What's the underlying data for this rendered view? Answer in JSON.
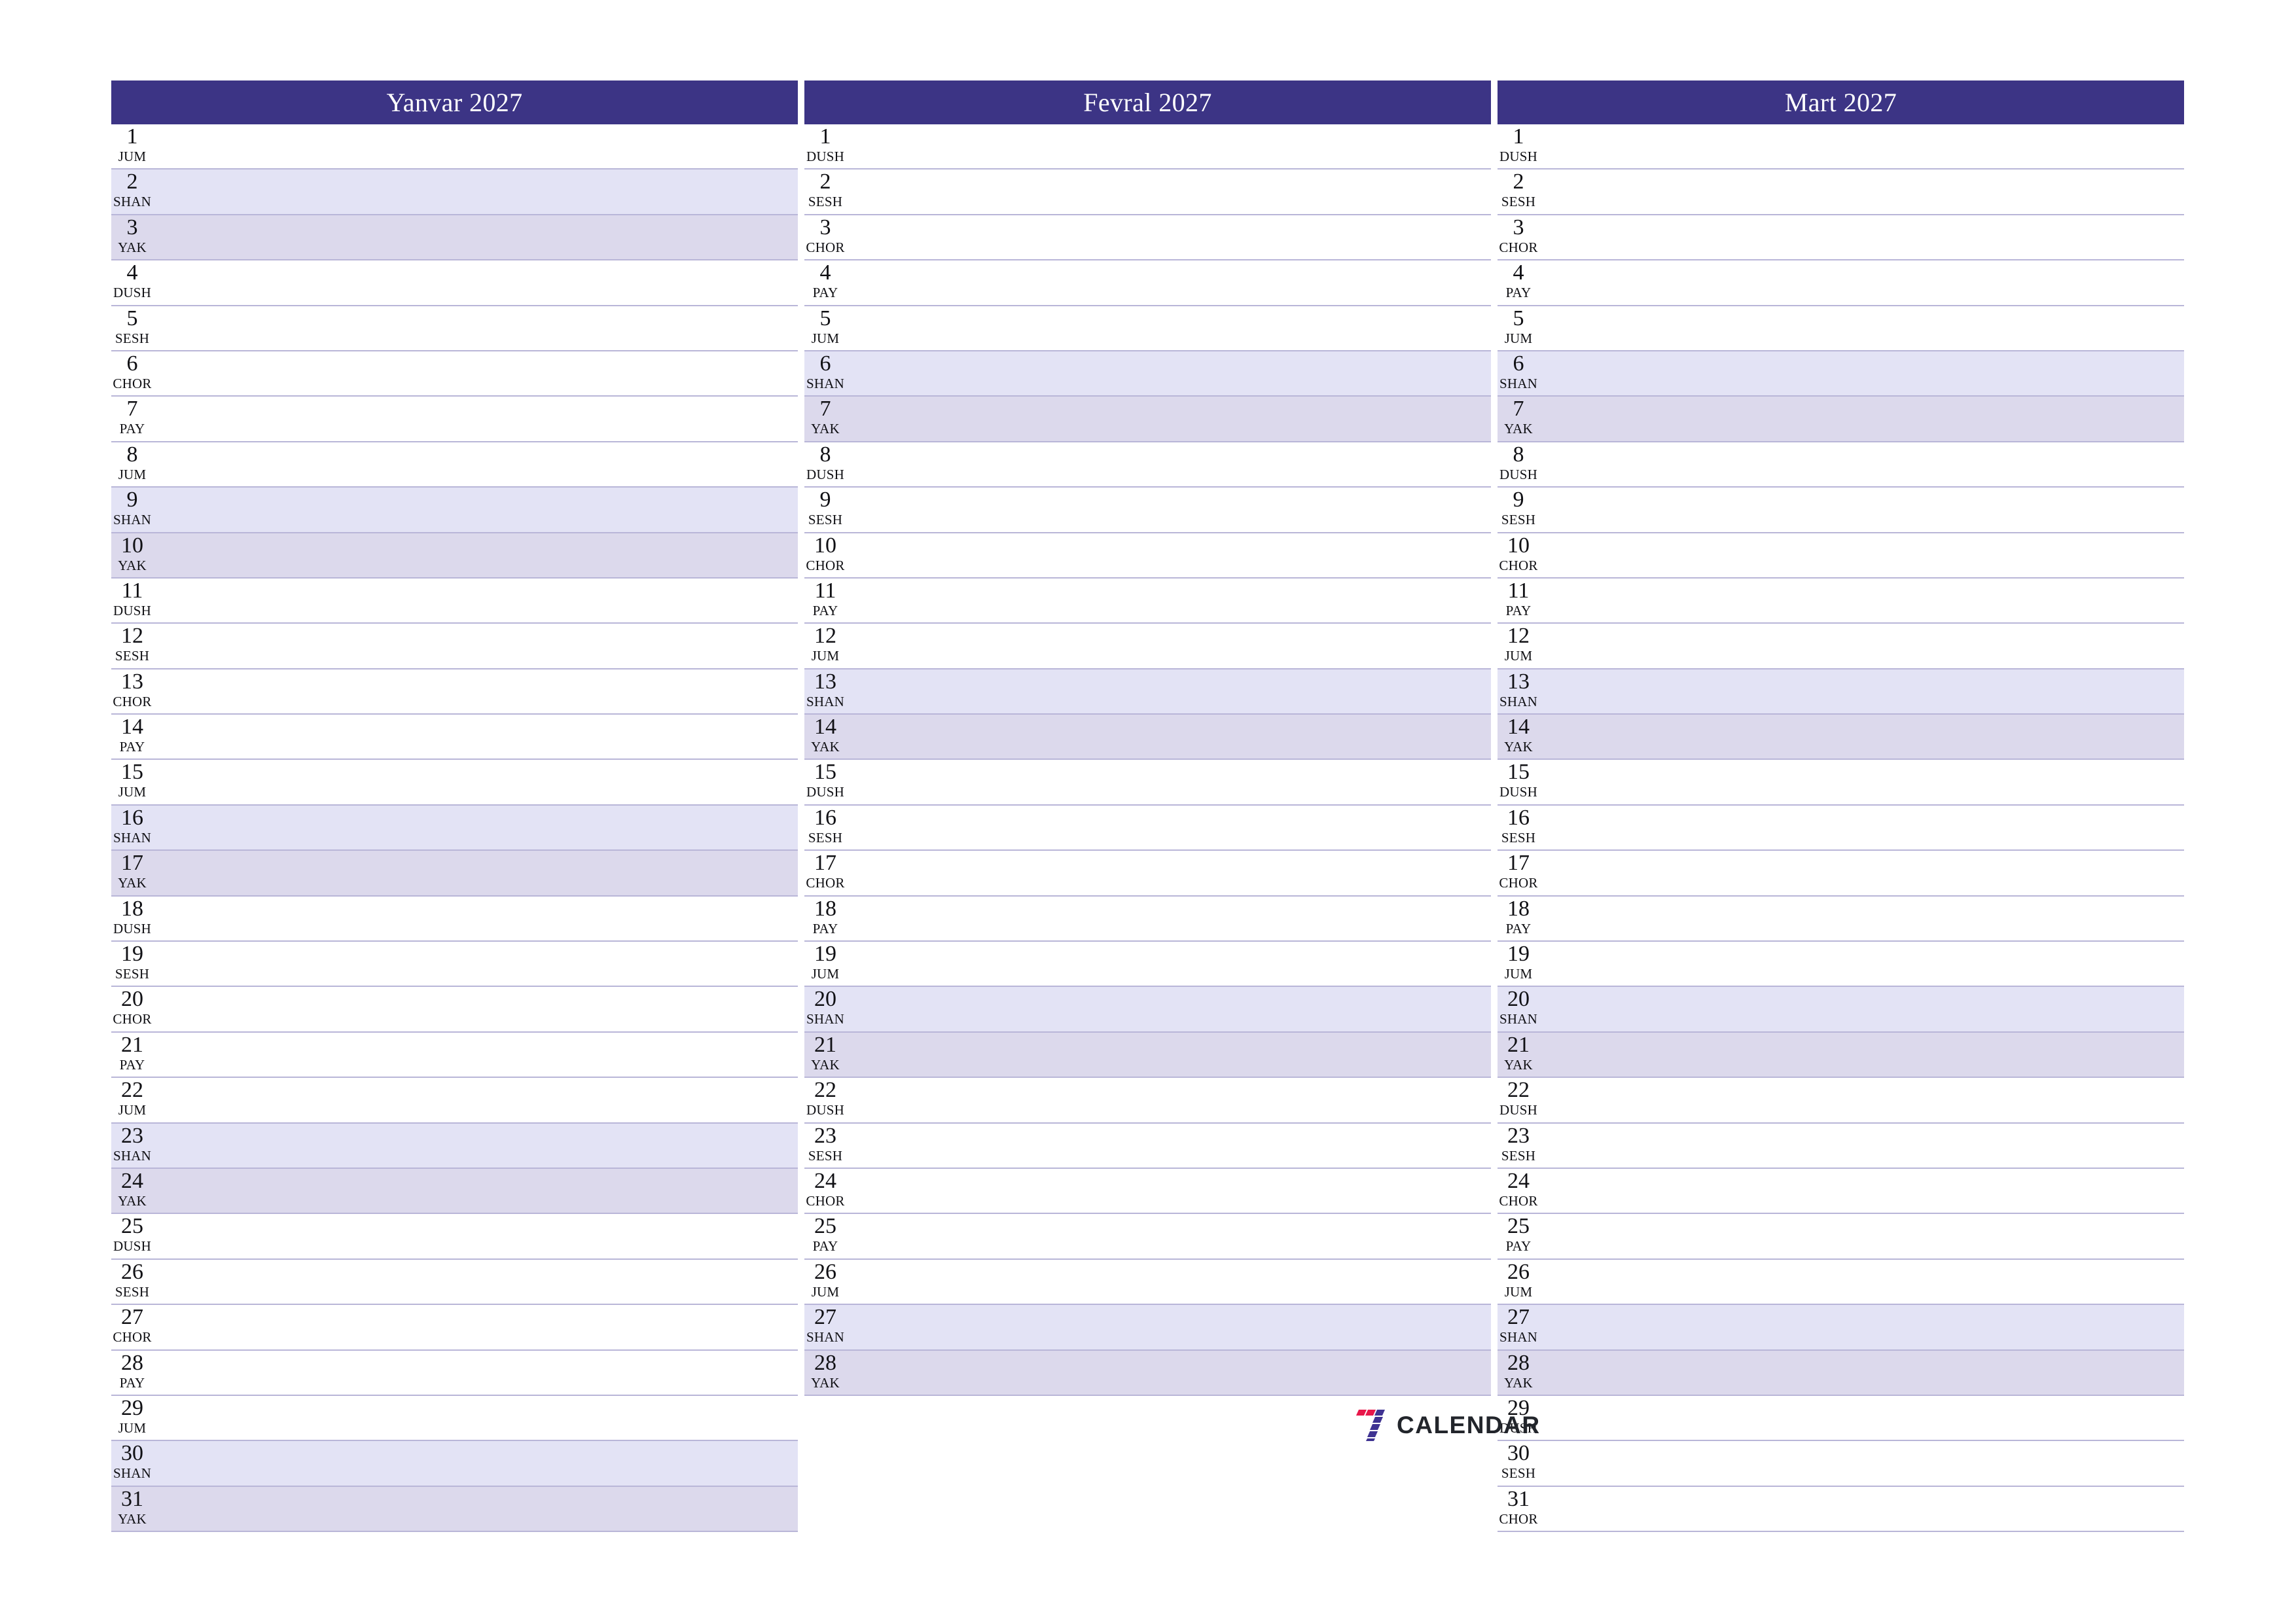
{
  "theme": {
    "header_bg": "#3c3485",
    "header_text": "#ffffff",
    "saturday_bg": "#e3e3f5",
    "sunday_bg": "#dcd9ec",
    "row_border": "#b9b6d8",
    "page_bg": "#ffffff",
    "text": "#101014",
    "logo_red": "#e8174a",
    "logo_blue": "#3f3392"
  },
  "brand": {
    "mark": "seven-logo-icon",
    "word": "CALENDAR"
  },
  "months": [
    {
      "title": "Yanvar 2027",
      "days": [
        {
          "num": "1",
          "name": "JUM",
          "type": "weekday"
        },
        {
          "num": "2",
          "name": "SHAN",
          "type": "saturday"
        },
        {
          "num": "3",
          "name": "YAK",
          "type": "sunday"
        },
        {
          "num": "4",
          "name": "DUSH",
          "type": "weekday"
        },
        {
          "num": "5",
          "name": "SESH",
          "type": "weekday"
        },
        {
          "num": "6",
          "name": "CHOR",
          "type": "weekday"
        },
        {
          "num": "7",
          "name": "PAY",
          "type": "weekday"
        },
        {
          "num": "8",
          "name": "JUM",
          "type": "weekday"
        },
        {
          "num": "9",
          "name": "SHAN",
          "type": "saturday"
        },
        {
          "num": "10",
          "name": "YAK",
          "type": "sunday"
        },
        {
          "num": "11",
          "name": "DUSH",
          "type": "weekday"
        },
        {
          "num": "12",
          "name": "SESH",
          "type": "weekday"
        },
        {
          "num": "13",
          "name": "CHOR",
          "type": "weekday"
        },
        {
          "num": "14",
          "name": "PAY",
          "type": "weekday"
        },
        {
          "num": "15",
          "name": "JUM",
          "type": "weekday"
        },
        {
          "num": "16",
          "name": "SHAN",
          "type": "saturday"
        },
        {
          "num": "17",
          "name": "YAK",
          "type": "sunday"
        },
        {
          "num": "18",
          "name": "DUSH",
          "type": "weekday"
        },
        {
          "num": "19",
          "name": "SESH",
          "type": "weekday"
        },
        {
          "num": "20",
          "name": "CHOR",
          "type": "weekday"
        },
        {
          "num": "21",
          "name": "PAY",
          "type": "weekday"
        },
        {
          "num": "22",
          "name": "JUM",
          "type": "weekday"
        },
        {
          "num": "23",
          "name": "SHAN",
          "type": "saturday"
        },
        {
          "num": "24",
          "name": "YAK",
          "type": "sunday"
        },
        {
          "num": "25",
          "name": "DUSH",
          "type": "weekday"
        },
        {
          "num": "26",
          "name": "SESH",
          "type": "weekday"
        },
        {
          "num": "27",
          "name": "CHOR",
          "type": "weekday"
        },
        {
          "num": "28",
          "name": "PAY",
          "type": "weekday"
        },
        {
          "num": "29",
          "name": "JUM",
          "type": "weekday"
        },
        {
          "num": "30",
          "name": "SHAN",
          "type": "saturday"
        },
        {
          "num": "31",
          "name": "YAK",
          "type": "sunday"
        }
      ]
    },
    {
      "title": "Fevral 2027",
      "days": [
        {
          "num": "1",
          "name": "DUSH",
          "type": "weekday"
        },
        {
          "num": "2",
          "name": "SESH",
          "type": "weekday"
        },
        {
          "num": "3",
          "name": "CHOR",
          "type": "weekday"
        },
        {
          "num": "4",
          "name": "PAY",
          "type": "weekday"
        },
        {
          "num": "5",
          "name": "JUM",
          "type": "weekday"
        },
        {
          "num": "6",
          "name": "SHAN",
          "type": "saturday"
        },
        {
          "num": "7",
          "name": "YAK",
          "type": "sunday"
        },
        {
          "num": "8",
          "name": "DUSH",
          "type": "weekday"
        },
        {
          "num": "9",
          "name": "SESH",
          "type": "weekday"
        },
        {
          "num": "10",
          "name": "CHOR",
          "type": "weekday"
        },
        {
          "num": "11",
          "name": "PAY",
          "type": "weekday"
        },
        {
          "num": "12",
          "name": "JUM",
          "type": "weekday"
        },
        {
          "num": "13",
          "name": "SHAN",
          "type": "saturday"
        },
        {
          "num": "14",
          "name": "YAK",
          "type": "sunday"
        },
        {
          "num": "15",
          "name": "DUSH",
          "type": "weekday"
        },
        {
          "num": "16",
          "name": "SESH",
          "type": "weekday"
        },
        {
          "num": "17",
          "name": "CHOR",
          "type": "weekday"
        },
        {
          "num": "18",
          "name": "PAY",
          "type": "weekday"
        },
        {
          "num": "19",
          "name": "JUM",
          "type": "weekday"
        },
        {
          "num": "20",
          "name": "SHAN",
          "type": "saturday"
        },
        {
          "num": "21",
          "name": "YAK",
          "type": "sunday"
        },
        {
          "num": "22",
          "name": "DUSH",
          "type": "weekday"
        },
        {
          "num": "23",
          "name": "SESH",
          "type": "weekday"
        },
        {
          "num": "24",
          "name": "CHOR",
          "type": "weekday"
        },
        {
          "num": "25",
          "name": "PAY",
          "type": "weekday"
        },
        {
          "num": "26",
          "name": "JUM",
          "type": "weekday"
        },
        {
          "num": "27",
          "name": "SHAN",
          "type": "saturday"
        },
        {
          "num": "28",
          "name": "YAK",
          "type": "sunday"
        }
      ]
    },
    {
      "title": "Mart 2027",
      "days": [
        {
          "num": "1",
          "name": "DUSH",
          "type": "weekday"
        },
        {
          "num": "2",
          "name": "SESH",
          "type": "weekday"
        },
        {
          "num": "3",
          "name": "CHOR",
          "type": "weekday"
        },
        {
          "num": "4",
          "name": "PAY",
          "type": "weekday"
        },
        {
          "num": "5",
          "name": "JUM",
          "type": "weekday"
        },
        {
          "num": "6",
          "name": "SHAN",
          "type": "saturday"
        },
        {
          "num": "7",
          "name": "YAK",
          "type": "sunday"
        },
        {
          "num": "8",
          "name": "DUSH",
          "type": "weekday"
        },
        {
          "num": "9",
          "name": "SESH",
          "type": "weekday"
        },
        {
          "num": "10",
          "name": "CHOR",
          "type": "weekday"
        },
        {
          "num": "11",
          "name": "PAY",
          "type": "weekday"
        },
        {
          "num": "12",
          "name": "JUM",
          "type": "weekday"
        },
        {
          "num": "13",
          "name": "SHAN",
          "type": "saturday"
        },
        {
          "num": "14",
          "name": "YAK",
          "type": "sunday"
        },
        {
          "num": "15",
          "name": "DUSH",
          "type": "weekday"
        },
        {
          "num": "16",
          "name": "SESH",
          "type": "weekday"
        },
        {
          "num": "17",
          "name": "CHOR",
          "type": "weekday"
        },
        {
          "num": "18",
          "name": "PAY",
          "type": "weekday"
        },
        {
          "num": "19",
          "name": "JUM",
          "type": "weekday"
        },
        {
          "num": "20",
          "name": "SHAN",
          "type": "saturday"
        },
        {
          "num": "21",
          "name": "YAK",
          "type": "sunday"
        },
        {
          "num": "22",
          "name": "DUSH",
          "type": "weekday"
        },
        {
          "num": "23",
          "name": "SESH",
          "type": "weekday"
        },
        {
          "num": "24",
          "name": "CHOR",
          "type": "weekday"
        },
        {
          "num": "25",
          "name": "PAY",
          "type": "weekday"
        },
        {
          "num": "26",
          "name": "JUM",
          "type": "weekday"
        },
        {
          "num": "27",
          "name": "SHAN",
          "type": "saturday"
        },
        {
          "num": "28",
          "name": "YAK",
          "type": "sunday"
        },
        {
          "num": "29",
          "name": "DUSH",
          "type": "weekday"
        },
        {
          "num": "30",
          "name": "SESH",
          "type": "weekday"
        },
        {
          "num": "31",
          "name": "CHOR",
          "type": "weekday"
        }
      ]
    }
  ]
}
